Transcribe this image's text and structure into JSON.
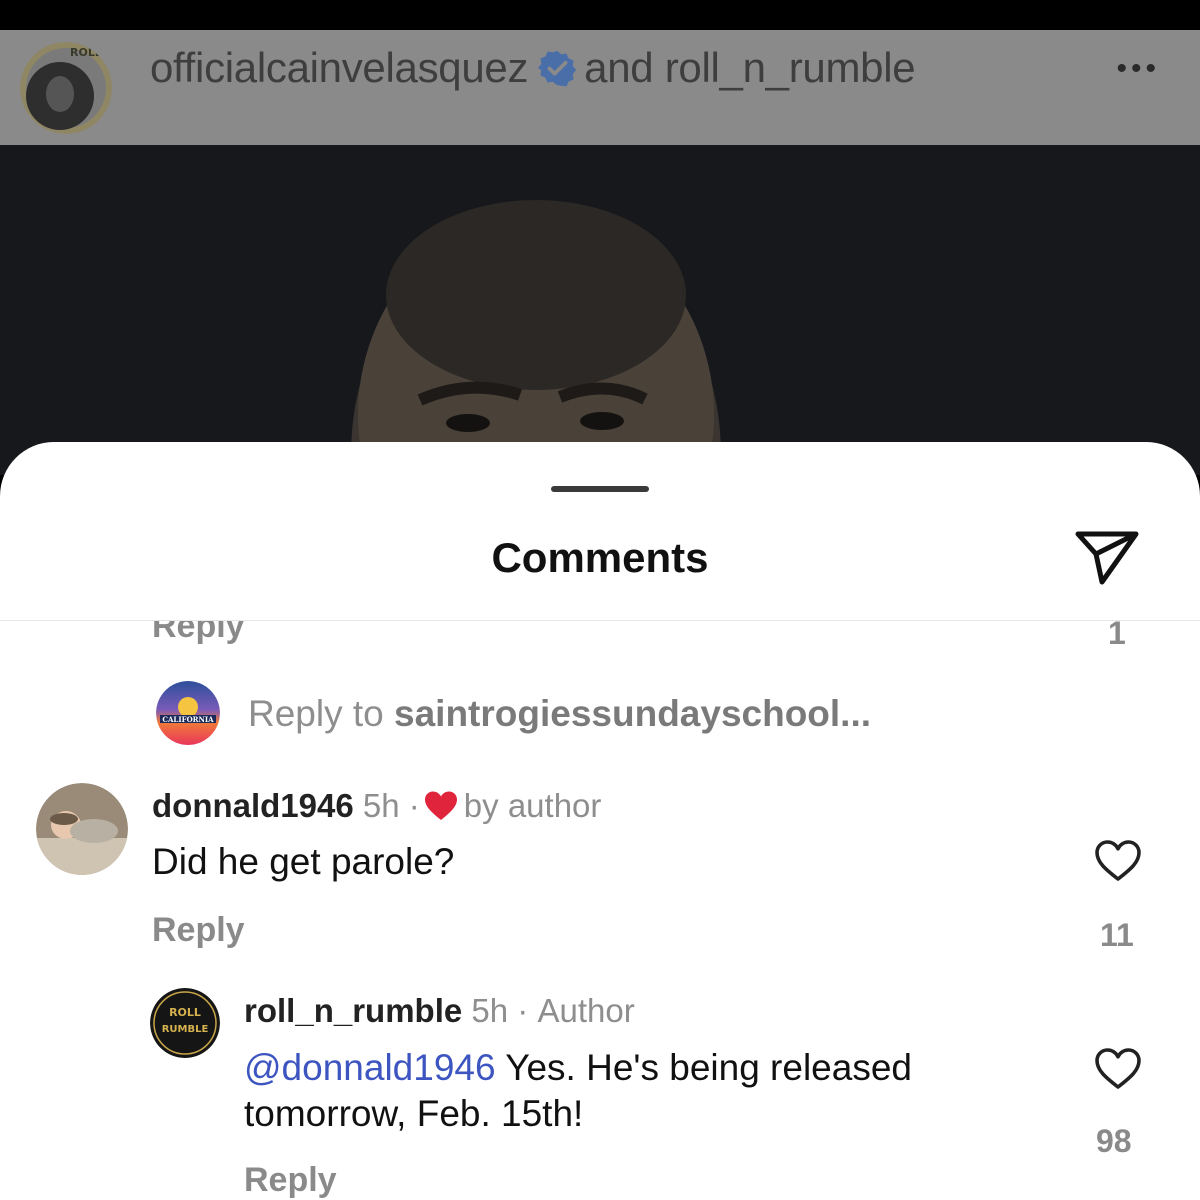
{
  "post_header": {
    "owner": "officialcainvelasquez",
    "connector": "and",
    "collaborator": "roll_n_rumble",
    "avatar_text": "ROLL LE",
    "more_icon": "more-horizontal-icon"
  },
  "sheet": {
    "title": "Comments",
    "share_icon": "send-icon"
  },
  "thread_context": {
    "previous_reply_label": "Reply",
    "previous_like_count": "1",
    "reply_prompt_prefix": "Reply to",
    "reply_prompt_user": "saintrogiessundayschool...",
    "reply_avatar_text": "CALIFORNIA"
  },
  "comments": [
    {
      "username": "donnald1946",
      "time": "5h",
      "separator": "·",
      "badge": "by author",
      "liked_by_author": true,
      "text": "Did he get parole?",
      "reply_label": "Reply",
      "like_count": "11"
    },
    {
      "username": "roll_n_rumble",
      "time": "5h",
      "separator": "·",
      "badge": "Author",
      "mention": "@donnald1946",
      "text_line1": "Yes. He's being released",
      "text_line2": "tomorrow, Feb. 15th!",
      "reply_label": "Reply",
      "like_count": "98",
      "avatar_text_top": "ROLL",
      "avatar_text_bottom": "RUMBLE"
    }
  ],
  "colors": {
    "accent_mention": "#3d55c0",
    "liked_heart": "#e0243b",
    "verified": "#4a6ea8",
    "muted_text": "#8e8e8e"
  }
}
